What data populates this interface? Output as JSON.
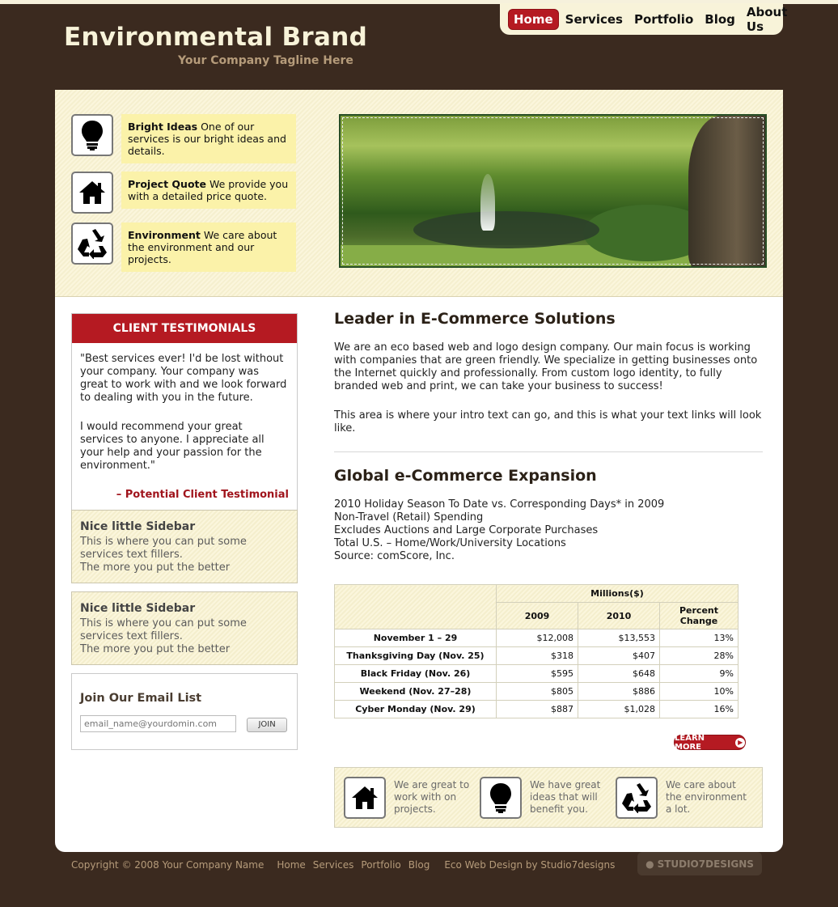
{
  "header": {
    "brand": "Environmental Brand",
    "tagline": "Your Company Tagline Here"
  },
  "nav": {
    "items": [
      "Home",
      "Services",
      "Portfolio",
      "Blog",
      "About Us"
    ]
  },
  "services": [
    {
      "title": "Bright Ideas",
      "text": " One of our services is our bright ideas and details.",
      "icon": "lightbulb-icon"
    },
    {
      "title": "Project Quote",
      "text": " We provide you with a detailed price quote.",
      "icon": "house-icon"
    },
    {
      "title": "Environment",
      "text": " We care about the environment and our projects.",
      "icon": "recycle-icon"
    }
  ],
  "testimonials": {
    "heading": "CLIENT TESTIMONIALS",
    "p1": "\"Best services ever! I'd be lost without your company. Your company was great to work with and we look forward to dealing with you in the future.",
    "p2": "I would recommend your great services to anyone. I appreciate all your help and your passion for the environment.\"",
    "signature": "– Potential Client Testimonial"
  },
  "sidebars": [
    {
      "title": "Nice little Sidebar",
      "line1": "This is where you can put some services text fillers.",
      "line2": "The more you put the better"
    },
    {
      "title": "Nice little Sidebar",
      "line1": "This is where you can put some services text fillers.",
      "line2": "The more you put the better"
    }
  ],
  "email": {
    "title": "Join Our Email List",
    "placeholder": "email_name@yourdomin.com",
    "button": "JOIN"
  },
  "intro": {
    "heading": "Leader in E-Commerce Solutions",
    "p1": "We are an eco based web and logo design company. Our main focus is working with companies that are green friendly. We specialize in getting businesses onto the Internet quickly and professionally. From custom logo identity, to fully branded web and print, we can take your business to success!",
    "p2": "This area is where your intro text can go, and this is what your text links will look like."
  },
  "expansion": {
    "heading": "Global e-Commerce Expansion",
    "lines": [
      "2010 Holiday Season To Date vs. Corresponding Days* in 2009",
      "Non-Travel (Retail) Spending",
      "Excludes Auctions and Large Corporate Purchases",
      "Total U.S. – Home/Work/University Locations",
      "Source: comScore, Inc."
    ]
  },
  "table": {
    "group_header": "Millions($)",
    "columns": [
      "2009",
      "2010",
      "Percent Change"
    ],
    "rows": [
      {
        "label": "November 1 – 29",
        "y2009": "$12,008",
        "y2010": "$13,553",
        "change": "13%"
      },
      {
        "label": "Thanksgiving Day (Nov. 25)",
        "y2009": "$318",
        "y2010": "$407",
        "change": "28%"
      },
      {
        "label": "Black Friday (Nov. 26)",
        "y2009": "$595",
        "y2010": "$648",
        "change": "9%"
      },
      {
        "label": "Weekend (Nov. 27–28)",
        "y2009": "$805",
        "y2010": "$886",
        "change": "10%"
      },
      {
        "label": "Cyber Monday (Nov. 29)",
        "y2009": "$887",
        "y2010": "$1,028",
        "change": "16%"
      }
    ]
  },
  "learn_more": "LEARN MORE",
  "promo": [
    {
      "text": "We are great to work with on projects.",
      "icon": "house-icon"
    },
    {
      "text": "We have great ideas that will benefit you.",
      "icon": "lightbulb-icon"
    },
    {
      "text": "We care about the environment a lot.",
      "icon": "recycle-icon"
    }
  ],
  "footer": {
    "copyright": "Copyright © 2008 Your Company Name",
    "links": [
      "Home",
      "Services",
      "Portfolio",
      "Blog"
    ],
    "credit": "Eco Web Design by Studio7designs",
    "badge": "STUDIO7DESIGNS"
  },
  "colors": {
    "background": "#3b2a1f",
    "accent": "#b51a22",
    "cream": "#f8f3d9"
  }
}
